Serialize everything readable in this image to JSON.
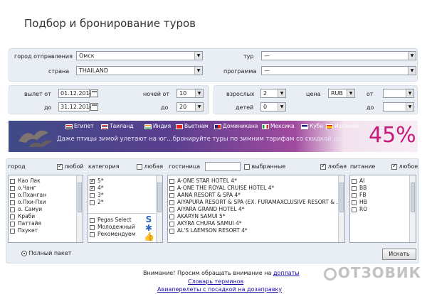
{
  "page": {
    "title": "Подбор и бронирование туров"
  },
  "top": {
    "departure_city_label": "город отправления",
    "departure_city_value": "Омск",
    "country_label": "страна",
    "country_value": "THAILAND",
    "tour_label": "тур",
    "tour_value": "—",
    "program_label": "программа",
    "program_value": "—"
  },
  "mid": {
    "depart_from_label": "вылет от",
    "depart_from_value": "01.12.2014",
    "depart_to_label": "до",
    "depart_to_value": "31.12.2014",
    "nights_from_label": "ночей от",
    "nights_from_value": "10",
    "nights_to_label": "до",
    "nights_to_value": "20",
    "adults_label": "взрослых",
    "adults_value": "2",
    "children_label": "детей",
    "children_value": "0",
    "price_label": "цена",
    "currency_value": "RUB",
    "price_from_label": "от",
    "price_to_label": "до"
  },
  "banner": {
    "tabs": [
      "Египет",
      "Таиланд",
      "Индия",
      "Вьетнам",
      "Доминикана",
      "Мексика",
      "Куба",
      "Испания"
    ],
    "text": "Даже птицы зимой улетают на юг…бронируйте туры по зимним тарифам со скидкой до",
    "discount": "45%"
  },
  "filters": {
    "city_label": "город",
    "any_label": "любой",
    "category_label": "категория",
    "any_f_label": "любая",
    "hotel_label": "гостиница",
    "selected_label": "выбранные",
    "any_hotel_label": "любая",
    "meal_label": "питание",
    "any_meal_label": "любое",
    "cities": [
      "Као Лак",
      "о.Чанг",
      "о.Пханган",
      "о.Пхи-Пхи",
      "о. Самуи",
      "Краби",
      "Паттайя",
      "Пхукет"
    ],
    "categories": [
      "5*",
      "4*",
      "3*",
      "2*"
    ],
    "categories_checked": [
      true,
      true,
      false,
      false
    ],
    "extra_categories": [
      "Pegas Select",
      "Молодежный",
      "Рекомендуем"
    ],
    "hotels": [
      "A-ONE STAR HOTEL 4*",
      "A-ONE THE ROYAL CRUISE HOTEL 4*",
      "AANA RESORT & SPA 4*",
      "AIYAPURA RESORT & SPA (EX. FURAMAXCLUSIVE RESORT & ...",
      "AIYARA GRAND HOTEL 4*",
      "AKARYN SAMUI 5*",
      "AKYRA CHURA SAMUI 4*",
      "AL'S LAEMSON RESORT 4*"
    ],
    "meals": [
      "AI",
      "BB",
      "FB",
      "HB",
      "RO"
    ]
  },
  "bottom": {
    "full_package_label": "Полный пакет",
    "search_button": "Искать",
    "notice_prefix": "Внимание! Просим обращать внимание на ",
    "notice_link": "доплаты",
    "terms_link": "Словарь терминов",
    "flights_link": "Авиаперелеты с посадкой на дозаправку"
  },
  "watermark": "ОТЗОВИК"
}
